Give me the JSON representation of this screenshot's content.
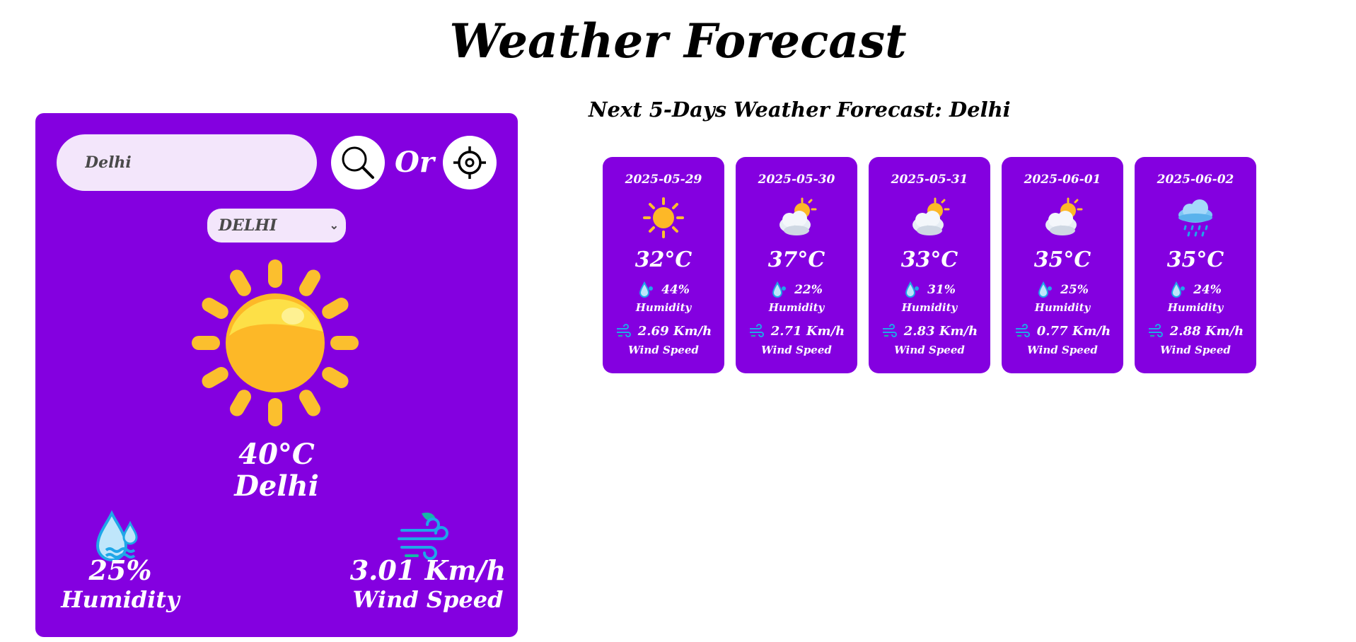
{
  "page": {
    "title": "Weather Forecast"
  },
  "current": {
    "search_value": "Delhi",
    "or_label": "Or",
    "select_value": "DELHI",
    "temperature": "40°C",
    "city": "Delhi",
    "humidity_value": "25%",
    "humidity_label": "Humidity",
    "wind_value": "3.01 Km/h",
    "wind_label": "Wind Speed",
    "icon": "sun-icon"
  },
  "forecast": {
    "heading": "Next 5-Days Weather Forecast: Delhi",
    "days": [
      {
        "date": "2025-05-29",
        "icon": "sun-icon",
        "temp": "32°C",
        "humidity": "44%",
        "humidity_label": "Humidity",
        "wind": "2.69 Km/h",
        "wind_label": "Wind Speed"
      },
      {
        "date": "2025-05-30",
        "icon": "partly-cloudy-icon",
        "temp": "37°C",
        "humidity": "22%",
        "humidity_label": "Humidity",
        "wind": "2.71 Km/h",
        "wind_label": "Wind Speed"
      },
      {
        "date": "2025-05-31",
        "icon": "partly-cloudy-icon",
        "temp": "33°C",
        "humidity": "31%",
        "humidity_label": "Humidity",
        "wind": "2.83 Km/h",
        "wind_label": "Wind Speed"
      },
      {
        "date": "2025-06-01",
        "icon": "partly-cloudy-icon",
        "temp": "35°C",
        "humidity": "25%",
        "humidity_label": "Humidity",
        "wind": "0.77 Km/h",
        "wind_label": "Wind Speed"
      },
      {
        "date": "2025-06-02",
        "icon": "rain-cloud-icon",
        "temp": "35°C",
        "humidity": "24%",
        "humidity_label": "Humidity",
        "wind": "2.88 Km/h",
        "wind_label": "Wind Speed"
      }
    ]
  },
  "colors": {
    "card": "#8400e0",
    "input_bg": "#f3e6fb",
    "sun": "#fdb827",
    "accent_blue": "#1fa7e8"
  }
}
